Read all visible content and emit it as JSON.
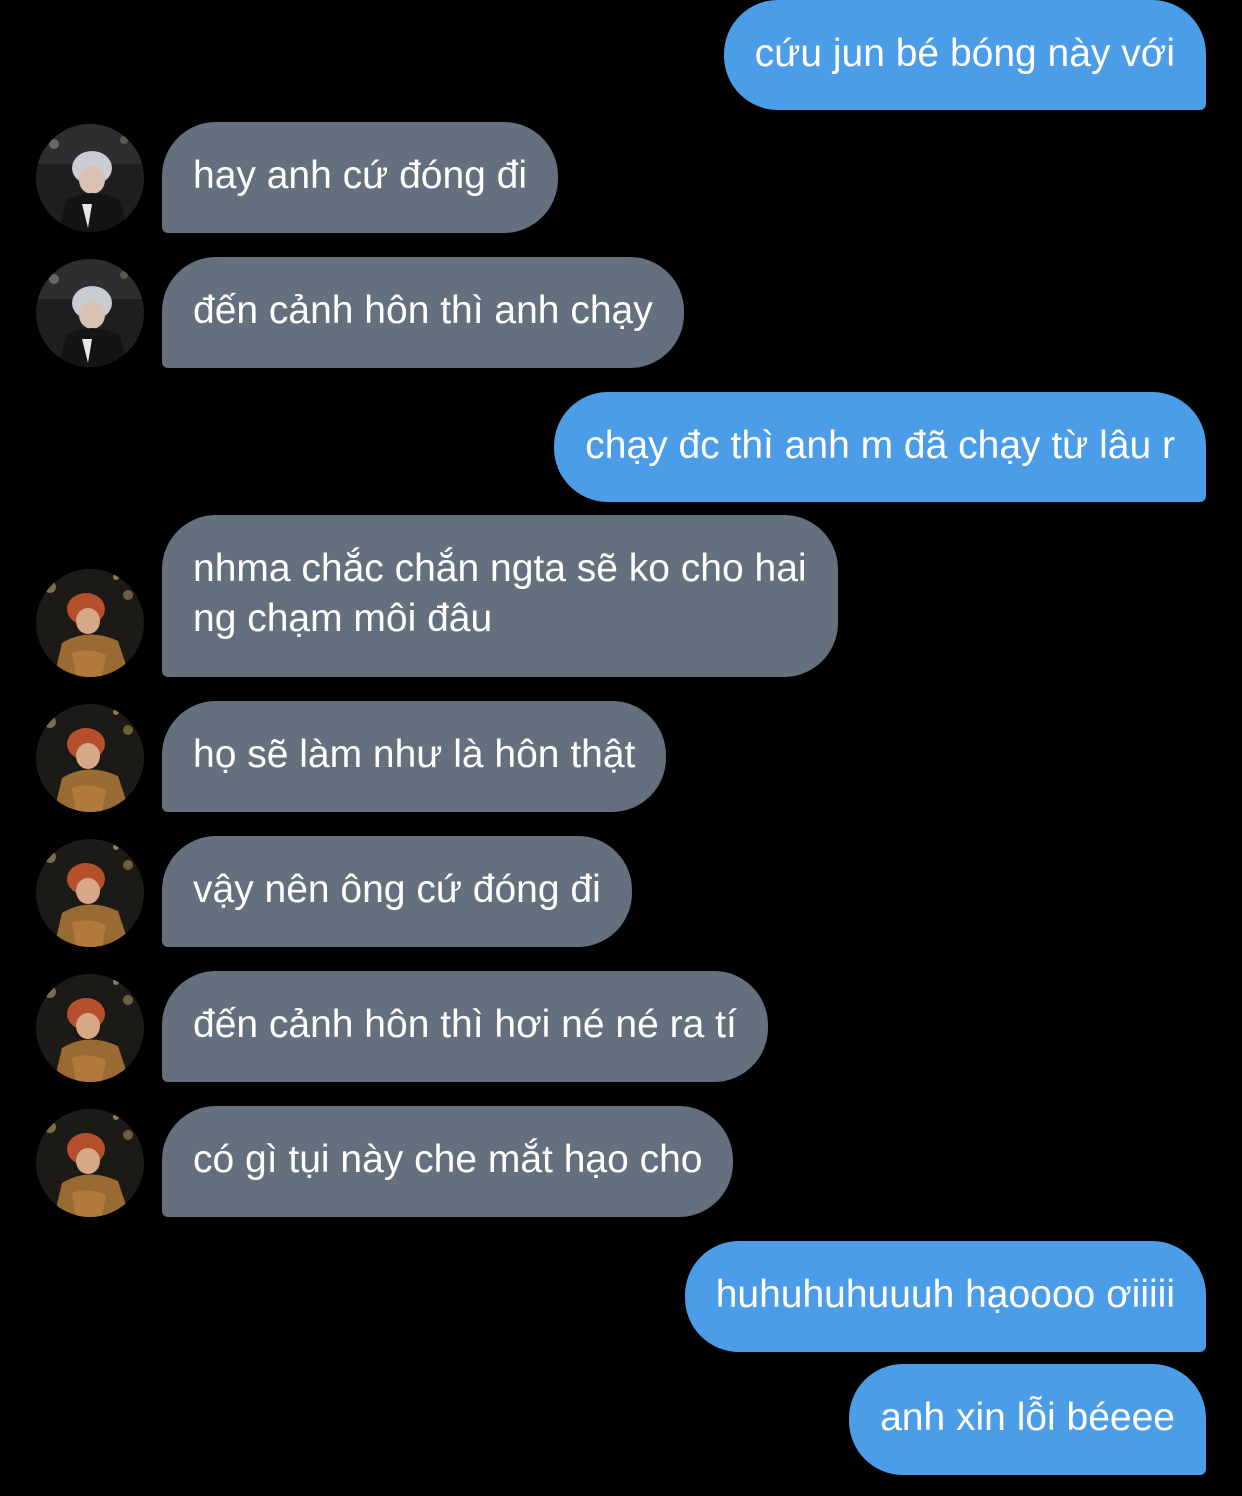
{
  "messages": [
    {
      "side": "out",
      "lines": [
        "cứu jun bé bóng này với"
      ]
    },
    {
      "side": "in",
      "sender": "a",
      "lines": [
        "hay anh cứ đóng đi"
      ]
    },
    {
      "side": "in",
      "sender": "a",
      "lines": [
        "đến cảnh hôn thì anh chạy"
      ]
    },
    {
      "side": "out",
      "lines": [
        "chạy đc thì anh m đã chạy từ lâu r"
      ]
    },
    {
      "side": "in",
      "sender": "b",
      "lines": [
        "nhma chắc chắn ngta sẽ ko cho hai",
        "ng chạm môi đâu"
      ]
    },
    {
      "side": "in",
      "sender": "b",
      "lines": [
        "họ sẽ làm như là hôn thật"
      ]
    },
    {
      "side": "in",
      "sender": "b",
      "lines": [
        "vậy nên ông cứ đóng đi"
      ]
    },
    {
      "side": "in",
      "sender": "b",
      "lines": [
        "đến cảnh hôn thì hơi né né ra tí"
      ]
    },
    {
      "side": "in",
      "sender": "b",
      "lines": [
        "có gì tụi này che mắt hạo cho"
      ]
    },
    {
      "side": "out",
      "lines": [
        "huhuhuhuuuh hạoooo ơiiiii"
      ]
    },
    {
      "side": "out",
      "lines": [
        "anh xin lỗi béeee"
      ]
    }
  ],
  "colors": {
    "background": "#000000",
    "outgoing_bubble": "#4b9de8",
    "incoming_bubble": "#65707f",
    "text": "#ffffff"
  },
  "avatars": {
    "a": {
      "icon": "profile-photo-avatar-gray-hair"
    },
    "b": {
      "icon": "profile-photo-avatar-orange-hair"
    }
  }
}
